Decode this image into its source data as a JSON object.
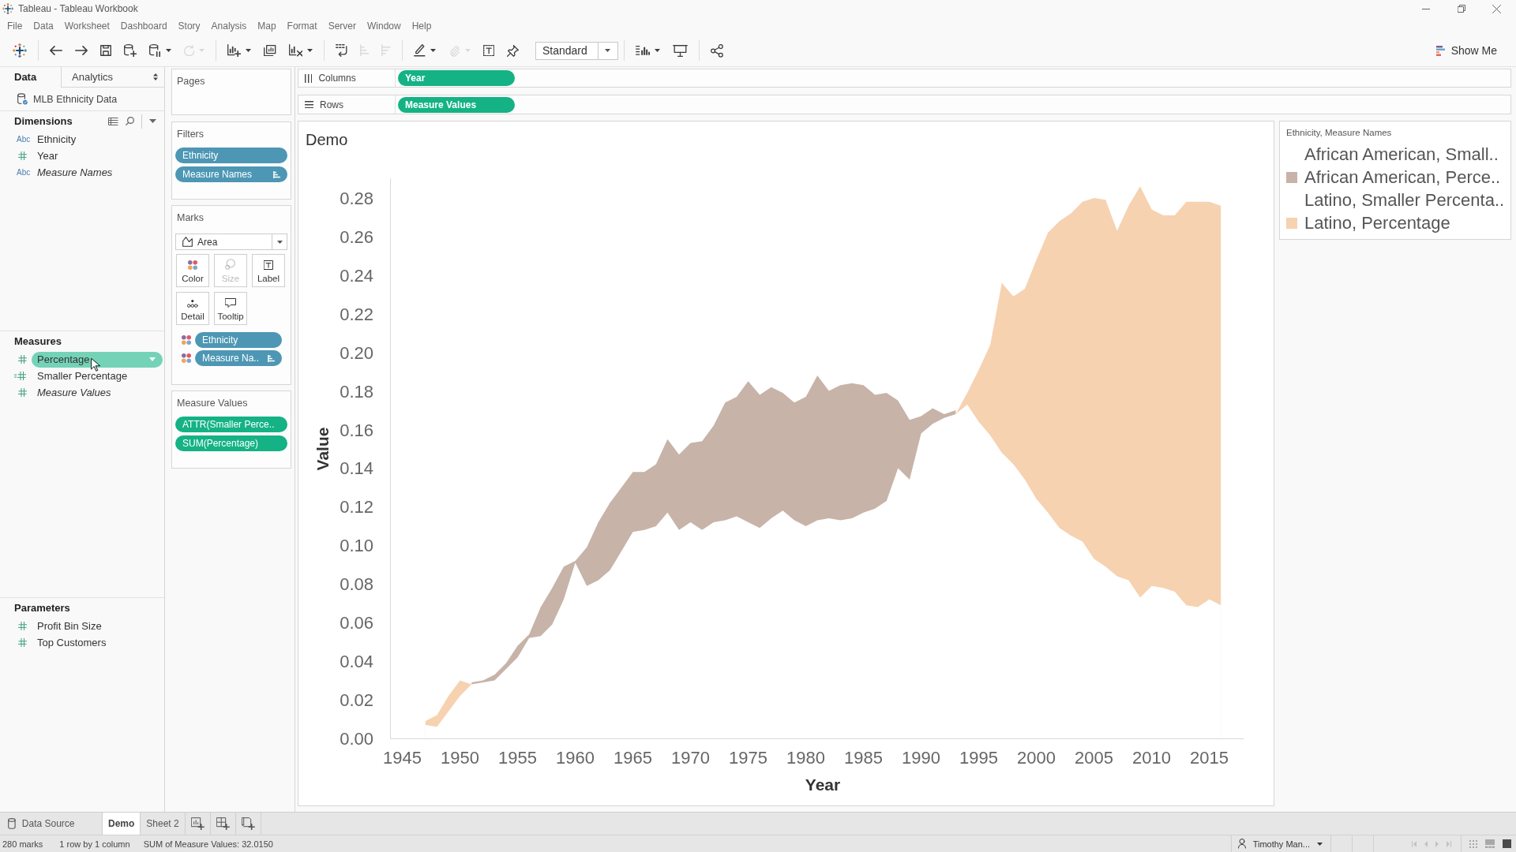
{
  "window": {
    "title": "Tableau - Tableau Workbook"
  },
  "menu": [
    "File",
    "Data",
    "Worksheet",
    "Dashboard",
    "Story",
    "Analysis",
    "Map",
    "Format",
    "Server",
    "Window",
    "Help"
  ],
  "toolbar": {
    "groups": [
      [
        {
          "kind": "button",
          "disabled": false,
          "menu": false
        }
      ],
      [
        {
          "kind": "button",
          "disabled": false,
          "menu": false
        },
        {
          "kind": "button",
          "disabled": false,
          "menu": false
        },
        {
          "kind": "button",
          "disabled": false,
          "menu": false
        },
        {
          "kind": "button",
          "disabled": false,
          "menu": false
        },
        {
          "kind": "button",
          "disabled": false,
          "menu": true
        },
        {
          "kind": "button",
          "disabled": true,
          "menu": true
        }
      ],
      [
        {
          "kind": "button",
          "disabled": false,
          "menu": true
        },
        {
          "kind": "button",
          "disabled": false,
          "menu": false
        },
        {
          "kind": "button",
          "disabled": false,
          "menu": true
        }
      ],
      [
        {
          "kind": "button",
          "disabled": false,
          "menu": false
        },
        {
          "kind": "button",
          "disabled": true,
          "menu": false
        },
        {
          "kind": "button",
          "disabled": true,
          "menu": false
        }
      ],
      [
        {
          "kind": "button",
          "disabled": false,
          "menu": true
        },
        {
          "kind": "button",
          "disabled": true,
          "menu": true
        },
        {
          "kind": "button",
          "disabled": false,
          "menu": false
        },
        {
          "kind": "button",
          "disabled": false,
          "menu": false
        },
        {
          "kind": "dropdown",
          "value": "Standard"
        }
      ],
      [
        {
          "kind": "button",
          "disabled": false,
          "menu": true
        },
        {
          "kind": "button",
          "disabled": false,
          "menu": false
        }
      ],
      [
        {
          "kind": "button",
          "disabled": false,
          "menu": false
        }
      ]
    ],
    "show_me": "Show Me"
  },
  "data_pane": {
    "tabs": [
      {
        "label": "Data",
        "selected": true
      },
      {
        "label": "Analytics",
        "selected": false
      }
    ],
    "data_source": "MLB Ethnicity Data",
    "sections": [
      {
        "title": "Dimensions",
        "tools": true,
        "fields": [
          {
            "name": "Ethnicity",
            "kind": "string",
            "type_label": "Abc",
            "generated": false,
            "selected": false,
            "hovered": false
          },
          {
            "name": "Year",
            "kind": "number",
            "generated": false,
            "selected": false,
            "hovered": false
          },
          {
            "name": "Measure Names",
            "kind": "string",
            "type_label": "Abc",
            "generated": true,
            "selected": false,
            "hovered": false
          }
        ]
      },
      {
        "title": "Measures",
        "tools": false,
        "fields": [
          {
            "name": "Percentage",
            "kind": "number",
            "generated": false,
            "selected": true,
            "hovered": true
          },
          {
            "name": "Smaller Percentage",
            "kind": "calculated",
            "generated": false,
            "selected": false,
            "hovered": false
          },
          {
            "name": "Measure Values",
            "kind": "number",
            "generated": true,
            "selected": false,
            "hovered": false
          }
        ]
      },
      {
        "title": "Parameters",
        "tools": false,
        "fields": [
          {
            "name": "Profit Bin Size",
            "kind": "number",
            "generated": false,
            "selected": false,
            "hovered": false
          },
          {
            "name": "Top Customers",
            "kind": "number",
            "generated": false,
            "selected": false,
            "hovered": false
          }
        ]
      }
    ]
  },
  "shelves": {
    "pages": {
      "title": "Pages"
    },
    "filters": {
      "title": "Filters",
      "pills": [
        {
          "label": "Ethnicity",
          "kind": "discrete",
          "sorted": false
        },
        {
          "label": "Measure Names",
          "kind": "discrete",
          "sorted": true
        }
      ]
    },
    "marks": {
      "title": "Marks",
      "mark_type": "Area",
      "buttons": [
        {
          "label": "Color",
          "disabled": false
        },
        {
          "label": "Size",
          "disabled": true
        },
        {
          "label": "Label",
          "disabled": false
        },
        {
          "label": "Detail",
          "disabled": false
        },
        {
          "label": "Tooltip",
          "disabled": false
        }
      ],
      "pills": [
        {
          "label": "Ethnicity",
          "kind": "discrete",
          "sorted": false,
          "on_color": true
        },
        {
          "label": "Measure Na..",
          "kind": "discrete",
          "sorted": true,
          "on_color": true
        }
      ]
    },
    "measure_values": {
      "title": "Measure Values",
      "pills": [
        {
          "label": "ATTR(Smaller Perce..",
          "kind": "continuous",
          "sorted": false
        },
        {
          "label": "SUM(Percentage)",
          "kind": "continuous",
          "sorted": false
        }
      ]
    }
  },
  "columns": {
    "label": "Columns",
    "pills": [
      {
        "label": "Year",
        "kind": "continuous",
        "sorted": false
      }
    ]
  },
  "rows": {
    "label": "Rows",
    "pills": [
      {
        "label": "Measure Values",
        "kind": "continuous",
        "sorted": false
      }
    ]
  },
  "view": {
    "chart_data": {
      "type": "area",
      "title": "Demo",
      "xlabel": "Year",
      "ylabel": "Value",
      "stacked": false,
      "x": [
        1947,
        1948,
        1949,
        1950,
        1951,
        1952,
        1953,
        1954,
        1955,
        1956,
        1957,
        1958,
        1959,
        1960,
        1961,
        1962,
        1963,
        1964,
        1965,
        1966,
        1967,
        1968,
        1969,
        1970,
        1971,
        1972,
        1973,
        1974,
        1975,
        1976,
        1977,
        1978,
        1979,
        1980,
        1981,
        1982,
        1983,
        1984,
        1985,
        1986,
        1987,
        1988,
        1989,
        1990,
        1991,
        1992,
        1993,
        1994,
        1995,
        1996,
        1997,
        1998,
        1999,
        2000,
        2001,
        2002,
        2003,
        2004,
        2005,
        2006,
        2007,
        2008,
        2009,
        2010,
        2011,
        2012,
        2013,
        2014,
        2015,
        2016
      ],
      "series": [
        {
          "color": "#c7b3a8",
          "values": [
            null,
            null,
            null,
            null,
            0.029,
            0.03,
            0.033,
            0.039,
            0.048,
            0.054,
            0.068,
            0.078,
            0.089,
            0.092,
            0.099,
            0.112,
            0.122,
            0.13,
            0.138,
            0.138,
            0.142,
            0.155,
            0.147,
            0.153,
            0.154,
            0.162,
            0.174,
            0.177,
            0.185,
            0.178,
            0.182,
            0.179,
            0.174,
            0.177,
            0.188,
            0.18,
            0.183,
            0.184,
            0.183,
            0.178,
            0.179,
            0.175,
            0.165,
            0.167,
            0.171,
            0.168,
            0.17,
            null,
            null,
            null,
            null,
            null,
            null,
            null,
            null,
            null,
            null,
            null,
            null,
            null,
            null,
            null,
            null,
            null,
            null,
            null,
            null,
            null,
            null,
            null
          ]
        },
        {
          "color": "#f6d2b1",
          "values": [
            0.009,
            0.012,
            0.022,
            0.03,
            0.028,
            null,
            null,
            null,
            null,
            null,
            null,
            null,
            null,
            null,
            null,
            null,
            null,
            null,
            null,
            null,
            null,
            null,
            null,
            null,
            null,
            null,
            null,
            null,
            null,
            null,
            null,
            null,
            null,
            null,
            null,
            null,
            null,
            null,
            null,
            null,
            null,
            null,
            null,
            null,
            null,
            null,
            0.168,
            0.179,
            0.191,
            0.204,
            0.236,
            0.229,
            0.233,
            0.248,
            0.262,
            0.268,
            0.272,
            0.278,
            0.28,
            0.279,
            0.263,
            0.276,
            0.286,
            0.274,
            0.271,
            0.271,
            0.278,
            0.278,
            0.278,
            0.276
          ]
        },
        {
          "color": "#ffffff",
          "values": [
            0.007,
            0.006,
            0.014,
            0.022,
            0.028,
            0.029,
            0.03,
            0.036,
            0.042,
            0.052,
            0.053,
            0.059,
            0.072,
            0.091,
            0.079,
            0.082,
            0.087,
            0.097,
            0.107,
            0.108,
            0.11,
            0.117,
            0.108,
            0.112,
            0.108,
            0.112,
            0.113,
            0.115,
            0.112,
            0.109,
            0.114,
            0.118,
            0.113,
            0.11,
            0.113,
            0.114,
            0.113,
            0.114,
            0.117,
            0.119,
            0.123,
            0.14,
            0.134,
            0.158,
            0.163,
            0.166,
            0.168,
            0.173,
            0.164,
            0.157,
            0.148,
            0.142,
            0.134,
            0.124,
            0.117,
            0.109,
            0.105,
            0.102,
            0.093,
            0.089,
            0.084,
            0.082,
            0.073,
            0.079,
            0.078,
            0.076,
            0.069,
            0.068,
            0.072,
            0.069
          ]
        }
      ],
      "xlim": [
        1944,
        2018
      ],
      "ylim": [
        0,
        0.29
      ],
      "xticks": [
        1945,
        1950,
        1955,
        1960,
        1965,
        1970,
        1975,
        1980,
        1985,
        1990,
        1995,
        2000,
        2005,
        2010,
        2015
      ],
      "yticks": [
        {
          "value": 0,
          "label": "0.00"
        },
        {
          "value": 0.02,
          "label": "0.02"
        },
        {
          "value": 0.04,
          "label": "0.04"
        },
        {
          "value": 0.06,
          "label": "0.06"
        },
        {
          "value": 0.08,
          "label": "0.08"
        },
        {
          "value": 0.1,
          "label": "0.10"
        },
        {
          "value": 0.12,
          "label": "0.12"
        },
        {
          "value": 0.14,
          "label": "0.14"
        },
        {
          "value": 0.16,
          "label": "0.16"
        },
        {
          "value": 0.18,
          "label": "0.18"
        },
        {
          "value": 0.2,
          "label": "0.20"
        },
        {
          "value": 0.22,
          "label": "0.22"
        },
        {
          "value": 0.24,
          "label": "0.24"
        },
        {
          "value": 0.26,
          "label": "0.26"
        },
        {
          "value": 0.28,
          "label": "0.28"
        }
      ]
    }
  },
  "legend": {
    "title": "Ethnicity, Measure Names",
    "items": [
      {
        "label": "African American, Small.."
      },
      {
        "label": "African American, Perce..",
        "color": "#c7b3a8"
      },
      {
        "label": "Latino, Smaller Percenta.."
      },
      {
        "label": "Latino, Percentage",
        "color": "#f6d2b1"
      }
    ]
  },
  "sheet_tabs": [
    {
      "label": "Data Source",
      "kind": "data_source",
      "selected": false
    },
    {
      "label": "Demo",
      "kind": "sheet",
      "selected": true
    },
    {
      "label": "Sheet 2",
      "kind": "sheet",
      "selected": false
    }
  ],
  "status_bar": {
    "marks": "280 marks",
    "layout": "1 row by 1 column",
    "summary": "SUM of Measure Values: 32.0150",
    "user": "Timothy Man...",
    "nav_buttons": [
      {
        "disabled": true
      },
      {
        "disabled": true
      },
      {
        "disabled": true
      },
      {
        "disabled": true
      }
    ],
    "view_buttons": [
      {
        "selected": false
      },
      {
        "selected": false
      },
      {
        "selected": true
      }
    ]
  }
}
